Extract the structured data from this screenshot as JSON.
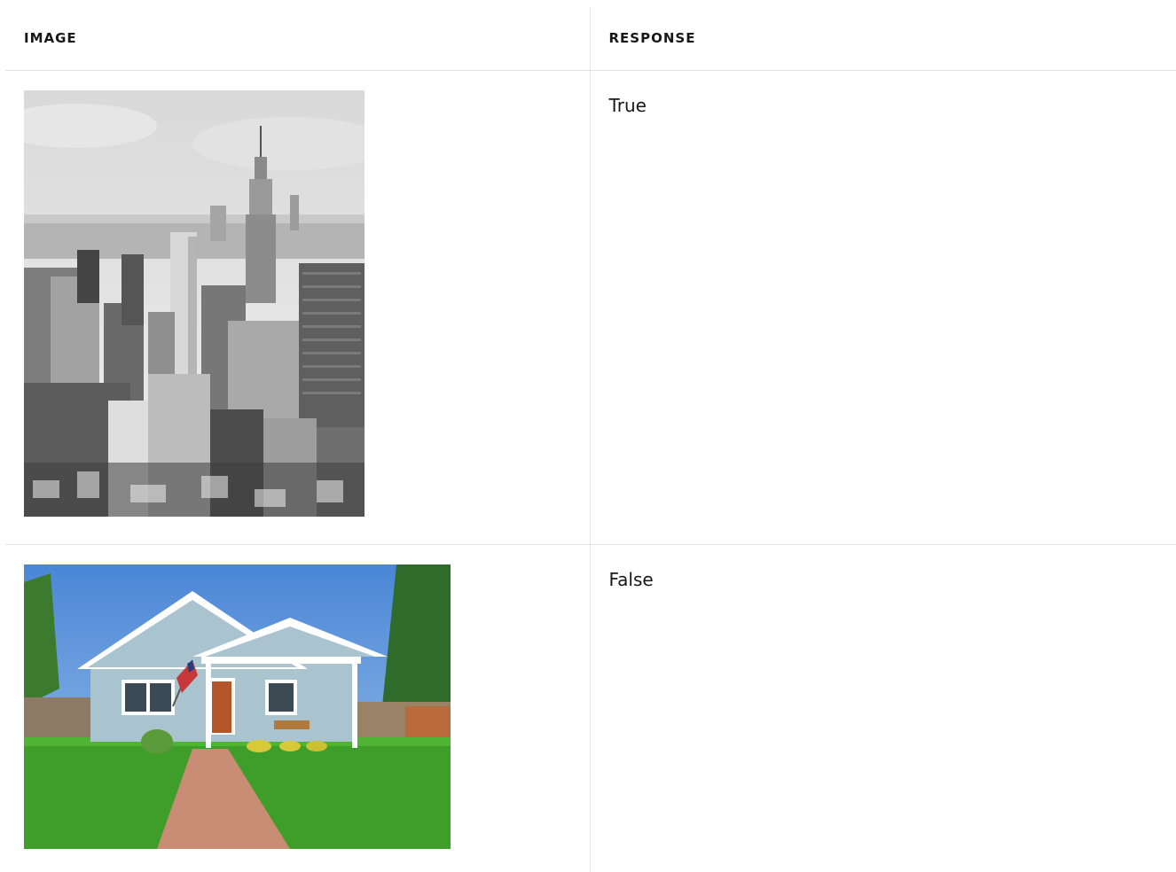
{
  "table": {
    "headers": [
      "IMAGE",
      "RESPONSE"
    ],
    "rows": [
      {
        "image_subject": "black-and-white city skyline photo",
        "response": "True"
      },
      {
        "image_subject": "house with lawn photo",
        "response": "False"
      }
    ]
  },
  "colors": {
    "header_text": "#171717",
    "border": "#e1e1e1",
    "sky_blue": "#5b8ed1",
    "grass": "#3f9e2a",
    "siding": "#a9c3cf"
  }
}
